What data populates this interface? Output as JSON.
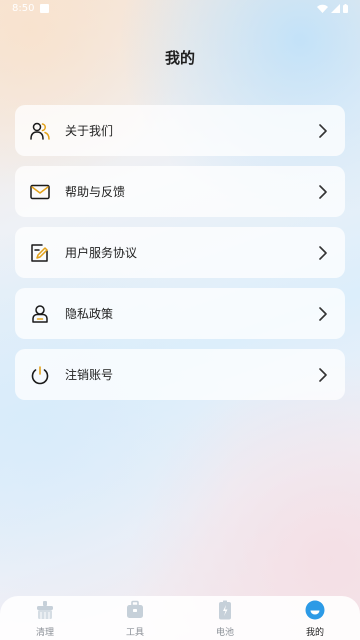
{
  "status_bar": {
    "time": "8:50"
  },
  "header": {
    "title": "我的"
  },
  "menu": {
    "items": [
      {
        "label": "关于我们",
        "icon": "people-icon"
      },
      {
        "label": "帮助与反馈",
        "icon": "mail-icon"
      },
      {
        "label": "用户服务协议",
        "icon": "document-edit-icon"
      },
      {
        "label": "隐私政策",
        "icon": "user-shield-icon"
      },
      {
        "label": "注销账号",
        "icon": "power-icon"
      }
    ]
  },
  "tab_bar": {
    "active_color": "#2c9ae6",
    "inactive_color": "#c6d0d9",
    "tabs": [
      {
        "label": "清理",
        "icon": "broom-icon",
        "active": false
      },
      {
        "label": "工具",
        "icon": "toolbox-icon",
        "active": false
      },
      {
        "label": "电池",
        "icon": "battery-icon",
        "active": false
      },
      {
        "label": "我的",
        "icon": "profile-icon",
        "active": true
      }
    ]
  }
}
